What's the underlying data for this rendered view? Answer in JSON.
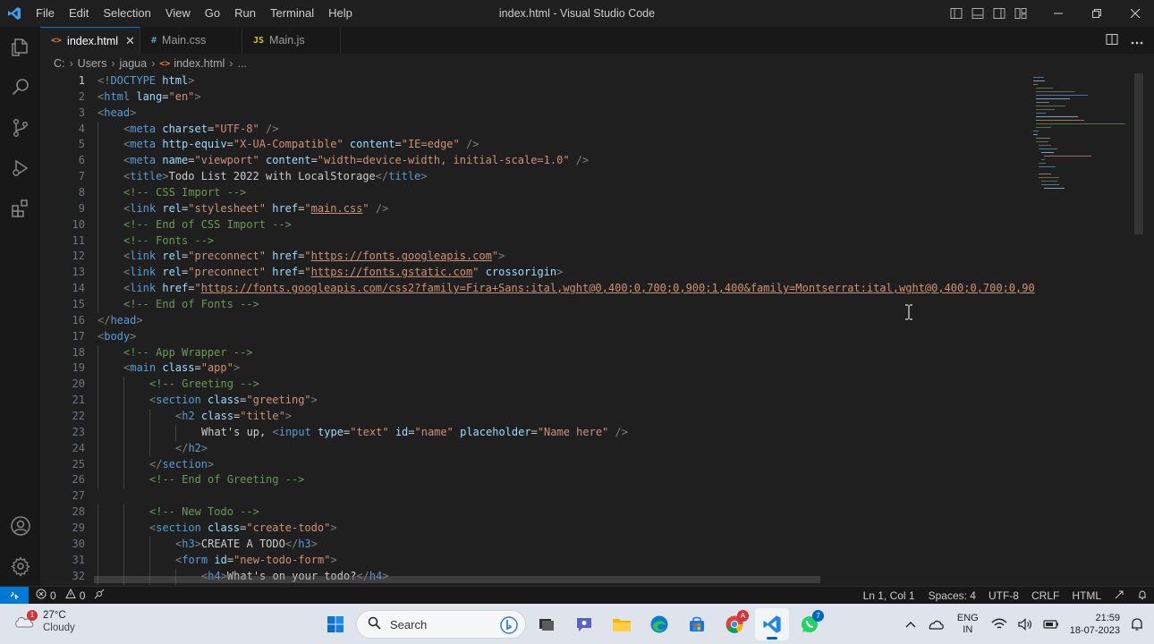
{
  "window": {
    "title": "index.html - Visual Studio Code",
    "menu": [
      "File",
      "Edit",
      "Selection",
      "View",
      "Go",
      "Run",
      "Terminal",
      "Help"
    ]
  },
  "activity_bar": [
    "files-icon",
    "search-icon",
    "source-control-icon",
    "run-debug-icon",
    "extensions-icon",
    "accounts-icon",
    "settings-gear-icon"
  ],
  "tabs": [
    {
      "label": "index.html",
      "icon": "<>",
      "icon_color": "#e37933",
      "active": true
    },
    {
      "label": "Main.css",
      "icon": "#",
      "icon_color": "#519aba",
      "active": false
    },
    {
      "label": "Main.js",
      "icon": "JS",
      "icon_color": "#cbcb41",
      "active": false
    }
  ],
  "breadcrumb": {
    "parts": [
      "C:",
      "Users",
      "jagua"
    ],
    "file": "index.html",
    "more": "..."
  },
  "editor": {
    "current_line": 1,
    "lines": [
      {
        "n": 1,
        "indent": 0,
        "t": [
          [
            "p",
            "<!"
          ],
          [
            "tg",
            "DOCTYPE "
          ],
          [
            "a",
            "html"
          ],
          [
            "p",
            ">"
          ]
        ]
      },
      {
        "n": 2,
        "indent": 0,
        "t": [
          [
            "p",
            "<"
          ],
          [
            "tg",
            "html "
          ],
          [
            "a",
            "lang"
          ],
          [
            "x",
            "="
          ],
          [
            "s",
            "\"en\""
          ],
          [
            "p",
            ">"
          ]
        ]
      },
      {
        "n": 3,
        "indent": 0,
        "t": [
          [
            "p",
            "<"
          ],
          [
            "tg",
            "head"
          ],
          [
            "p",
            ">"
          ]
        ]
      },
      {
        "n": 4,
        "indent": 1,
        "t": [
          [
            "p",
            "<"
          ],
          [
            "tg",
            "meta "
          ],
          [
            "a",
            "charset"
          ],
          [
            "x",
            "="
          ],
          [
            "s",
            "\"UTF-8\""
          ],
          [
            "x",
            " "
          ],
          [
            "p",
            "/>"
          ]
        ]
      },
      {
        "n": 5,
        "indent": 1,
        "t": [
          [
            "p",
            "<"
          ],
          [
            "tg",
            "meta "
          ],
          [
            "a",
            "http-equiv"
          ],
          [
            "x",
            "="
          ],
          [
            "s",
            "\"X-UA-Compatible\""
          ],
          [
            "x",
            " "
          ],
          [
            "a",
            "content"
          ],
          [
            "x",
            "="
          ],
          [
            "s",
            "\"IE=edge\""
          ],
          [
            "x",
            " "
          ],
          [
            "p",
            "/>"
          ]
        ]
      },
      {
        "n": 6,
        "indent": 1,
        "t": [
          [
            "p",
            "<"
          ],
          [
            "tg",
            "meta "
          ],
          [
            "a",
            "name"
          ],
          [
            "x",
            "="
          ],
          [
            "s",
            "\"viewport\""
          ],
          [
            "x",
            " "
          ],
          [
            "a",
            "content"
          ],
          [
            "x",
            "="
          ],
          [
            "s",
            "\"width=device-width, initial-scale=1.0\""
          ],
          [
            "x",
            " "
          ],
          [
            "p",
            "/>"
          ]
        ]
      },
      {
        "n": 7,
        "indent": 1,
        "t": [
          [
            "p",
            "<"
          ],
          [
            "tg",
            "title"
          ],
          [
            "p",
            ">"
          ],
          [
            "x",
            "Todo List 2022 with LocalStorage"
          ],
          [
            "p",
            "</"
          ],
          [
            "tg",
            "title"
          ],
          [
            "p",
            ">"
          ]
        ]
      },
      {
        "n": 8,
        "indent": 1,
        "t": [
          [
            "c",
            "<!-- CSS Import -->"
          ]
        ]
      },
      {
        "n": 9,
        "indent": 1,
        "t": [
          [
            "p",
            "<"
          ],
          [
            "tg",
            "link "
          ],
          [
            "a",
            "rel"
          ],
          [
            "x",
            "="
          ],
          [
            "s",
            "\"stylesheet\""
          ],
          [
            "x",
            " "
          ],
          [
            "a",
            "href"
          ],
          [
            "x",
            "="
          ],
          [
            "s",
            "\""
          ],
          [
            "u",
            "main.css"
          ],
          [
            "s",
            "\""
          ],
          [
            "x",
            " "
          ],
          [
            "p",
            "/>"
          ]
        ]
      },
      {
        "n": 10,
        "indent": 1,
        "t": [
          [
            "c",
            "<!-- End of CSS Import -->"
          ]
        ]
      },
      {
        "n": 11,
        "indent": 1,
        "t": [
          [
            "c",
            "<!-- Fonts -->"
          ]
        ]
      },
      {
        "n": 12,
        "indent": 1,
        "t": [
          [
            "p",
            "<"
          ],
          [
            "tg",
            "link "
          ],
          [
            "a",
            "rel"
          ],
          [
            "x",
            "="
          ],
          [
            "s",
            "\"preconnect\""
          ],
          [
            "x",
            " "
          ],
          [
            "a",
            "href"
          ],
          [
            "x",
            "="
          ],
          [
            "s",
            "\""
          ],
          [
            "u",
            "https://fonts.googleapis.com"
          ],
          [
            "s",
            "\""
          ],
          [
            "p",
            ">"
          ]
        ]
      },
      {
        "n": 13,
        "indent": 1,
        "t": [
          [
            "p",
            "<"
          ],
          [
            "tg",
            "link "
          ],
          [
            "a",
            "rel"
          ],
          [
            "x",
            "="
          ],
          [
            "s",
            "\"preconnect\""
          ],
          [
            "x",
            " "
          ],
          [
            "a",
            "href"
          ],
          [
            "x",
            "="
          ],
          [
            "s",
            "\""
          ],
          [
            "u",
            "https://fonts.gstatic.com"
          ],
          [
            "s",
            "\""
          ],
          [
            "x",
            " "
          ],
          [
            "a",
            "crossorigin"
          ],
          [
            "p",
            ">"
          ]
        ]
      },
      {
        "n": 14,
        "indent": 1,
        "t": [
          [
            "p",
            "<"
          ],
          [
            "tg",
            "link "
          ],
          [
            "a",
            "href"
          ],
          [
            "x",
            "="
          ],
          [
            "s",
            "\""
          ],
          [
            "u",
            "https://fonts.googleapis.com/css2?family=Fira+Sans:ital,wght@0,400;0,700;0,900;1,400&family=Montserrat:ital,wght@0,400;0,700;0,90"
          ]
        ]
      },
      {
        "n": 15,
        "indent": 1,
        "t": [
          [
            "c",
            "<!-- End of Fonts -->"
          ]
        ]
      },
      {
        "n": 16,
        "indent": 0,
        "t": [
          [
            "p",
            "</"
          ],
          [
            "tg",
            "head"
          ],
          [
            "p",
            ">"
          ]
        ]
      },
      {
        "n": 17,
        "indent": 0,
        "t": [
          [
            "p",
            "<"
          ],
          [
            "tg",
            "body"
          ],
          [
            "p",
            ">"
          ]
        ]
      },
      {
        "n": 18,
        "indent": 1,
        "t": [
          [
            "c",
            "<!-- App Wrapper -->"
          ]
        ]
      },
      {
        "n": 19,
        "indent": 1,
        "t": [
          [
            "p",
            "<"
          ],
          [
            "tg",
            "main "
          ],
          [
            "a",
            "class"
          ],
          [
            "x",
            "="
          ],
          [
            "s",
            "\"app\""
          ],
          [
            "p",
            ">"
          ]
        ]
      },
      {
        "n": 20,
        "indent": 2,
        "t": [
          [
            "c",
            "<!-- Greeting -->"
          ]
        ]
      },
      {
        "n": 21,
        "indent": 2,
        "t": [
          [
            "p",
            "<"
          ],
          [
            "tg",
            "section "
          ],
          [
            "a",
            "class"
          ],
          [
            "x",
            "="
          ],
          [
            "s",
            "\"greeting\""
          ],
          [
            "p",
            ">"
          ]
        ]
      },
      {
        "n": 22,
        "indent": 3,
        "t": [
          [
            "p",
            "<"
          ],
          [
            "tg",
            "h2 "
          ],
          [
            "a",
            "class"
          ],
          [
            "x",
            "="
          ],
          [
            "s",
            "\"title\""
          ],
          [
            "p",
            ">"
          ]
        ]
      },
      {
        "n": 23,
        "indent": 4,
        "t": [
          [
            "x",
            "What's up, "
          ],
          [
            "p",
            "<"
          ],
          [
            "tg",
            "input "
          ],
          [
            "a",
            "type"
          ],
          [
            "x",
            "="
          ],
          [
            "s",
            "\"text\""
          ],
          [
            "x",
            " "
          ],
          [
            "a",
            "id"
          ],
          [
            "x",
            "="
          ],
          [
            "s",
            "\"name\""
          ],
          [
            "x",
            " "
          ],
          [
            "a",
            "placeholder"
          ],
          [
            "x",
            "="
          ],
          [
            "s",
            "\"Name here\""
          ],
          [
            "x",
            " "
          ],
          [
            "p",
            "/>"
          ]
        ]
      },
      {
        "n": 24,
        "indent": 3,
        "t": [
          [
            "p",
            "</"
          ],
          [
            "tg",
            "h2"
          ],
          [
            "p",
            ">"
          ]
        ]
      },
      {
        "n": 25,
        "indent": 2,
        "t": [
          [
            "p",
            "</"
          ],
          [
            "tg",
            "section"
          ],
          [
            "p",
            ">"
          ]
        ]
      },
      {
        "n": 26,
        "indent": 2,
        "t": [
          [
            "c",
            "<!-- End of Greeting -->"
          ]
        ]
      },
      {
        "n": 27,
        "indent": 0,
        "t": []
      },
      {
        "n": 28,
        "indent": 2,
        "t": [
          [
            "c",
            "<!-- New Todo -->"
          ]
        ]
      },
      {
        "n": 29,
        "indent": 2,
        "t": [
          [
            "p",
            "<"
          ],
          [
            "tg",
            "section "
          ],
          [
            "a",
            "class"
          ],
          [
            "x",
            "="
          ],
          [
            "s",
            "\"create-todo\""
          ],
          [
            "p",
            ">"
          ]
        ]
      },
      {
        "n": 30,
        "indent": 3,
        "t": [
          [
            "p",
            "<"
          ],
          [
            "tg",
            "h3"
          ],
          [
            "p",
            ">"
          ],
          [
            "x",
            "CREATE A TODO"
          ],
          [
            "p",
            "</"
          ],
          [
            "tg",
            "h3"
          ],
          [
            "p",
            ">"
          ]
        ]
      },
      {
        "n": 31,
        "indent": 3,
        "t": [
          [
            "p",
            "<"
          ],
          [
            "tg",
            "form "
          ],
          [
            "a",
            "id"
          ],
          [
            "x",
            "="
          ],
          [
            "s",
            "\"new-todo-form\""
          ],
          [
            "p",
            ">"
          ]
        ]
      },
      {
        "n": 32,
        "indent": 4,
        "t": [
          [
            "p",
            "<"
          ],
          [
            "tg",
            "h4"
          ],
          [
            "p",
            ">"
          ],
          [
            "x",
            "What's on your todo?"
          ],
          [
            "p",
            "</"
          ],
          [
            "tg",
            "h4"
          ],
          [
            "p",
            ">"
          ]
        ]
      }
    ]
  },
  "status_bar": {
    "errors": "0",
    "warnings": "0",
    "position": "Ln 1, Col 1",
    "spaces": "Spaces: 4",
    "encoding": "UTF-8",
    "eol": "CRLF",
    "language": "HTML"
  },
  "taskbar": {
    "weather_temp": "27°C",
    "weather_cond": "Cloudy",
    "weather_badge": "1",
    "search_placeholder": "Search",
    "lang_1": "ENG",
    "lang_2": "IN",
    "time": "21:59",
    "date": "18-07-2023",
    "chrome_badge": "A",
    "whatsapp_badge": "7"
  }
}
